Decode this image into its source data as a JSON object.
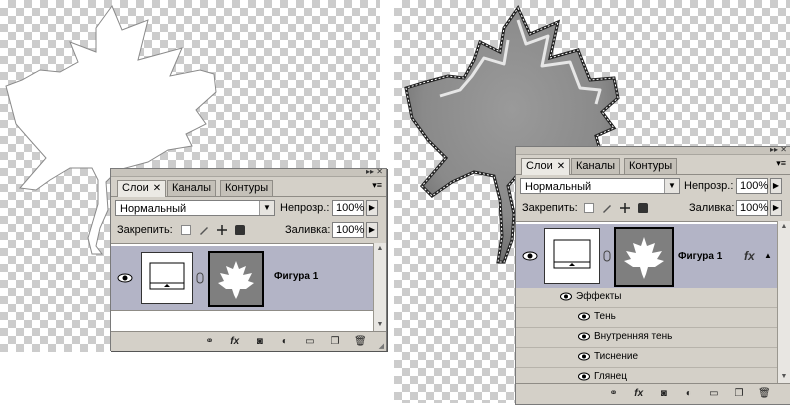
{
  "panels": [
    {
      "id": "left",
      "tabs": [
        {
          "label": "Слои",
          "active": true,
          "closable": true
        },
        {
          "label": "Каналы",
          "active": false,
          "closable": false
        },
        {
          "label": "Контуры",
          "active": false,
          "closable": false
        }
      ],
      "blend_mode": "Нормальный",
      "opacity_label": "Непрозр.:",
      "opacity_value": "100%",
      "lock_label": "Закрепить:",
      "fill_label": "Заливка:",
      "fill_value": "100%",
      "layer_name": "Фигура 1",
      "effects_label": "",
      "effects": []
    },
    {
      "id": "right",
      "tabs": [
        {
          "label": "Слои",
          "active": true,
          "closable": true
        },
        {
          "label": "Каналы",
          "active": false,
          "closable": false
        },
        {
          "label": "Контуры",
          "active": false,
          "closable": false
        }
      ],
      "blend_mode": "Нормальный",
      "opacity_label": "Непрозр.:",
      "opacity_value": "100%",
      "lock_label": "Закрепить:",
      "fill_label": "Заливка:",
      "fill_value": "100%",
      "layer_name": "Фигура 1",
      "fx_symbol": "fx",
      "effects_label": "Эффекты",
      "effects": [
        "Тень",
        "Внутренняя тень",
        "Тиснение",
        "Глянец"
      ]
    }
  ],
  "icons": {
    "visibility": "eye-icon",
    "lock_transparency": "lock-transparent-icon",
    "lock_paint": "brush-icon",
    "lock_move": "move-icon",
    "lock_all": "lock-icon",
    "bottom": [
      "link-layers-icon",
      "fx-icon",
      "mask-icon",
      "adjustment-icon",
      "group-folder-icon",
      "new-layer-icon",
      "trash-icon"
    ]
  },
  "colors": {
    "panel_bg": "#d4d0c8",
    "selected_layer": "#b3b4c6",
    "mask_fill": "#7f7f7f",
    "leaf_gray": "#8c8c8c"
  }
}
